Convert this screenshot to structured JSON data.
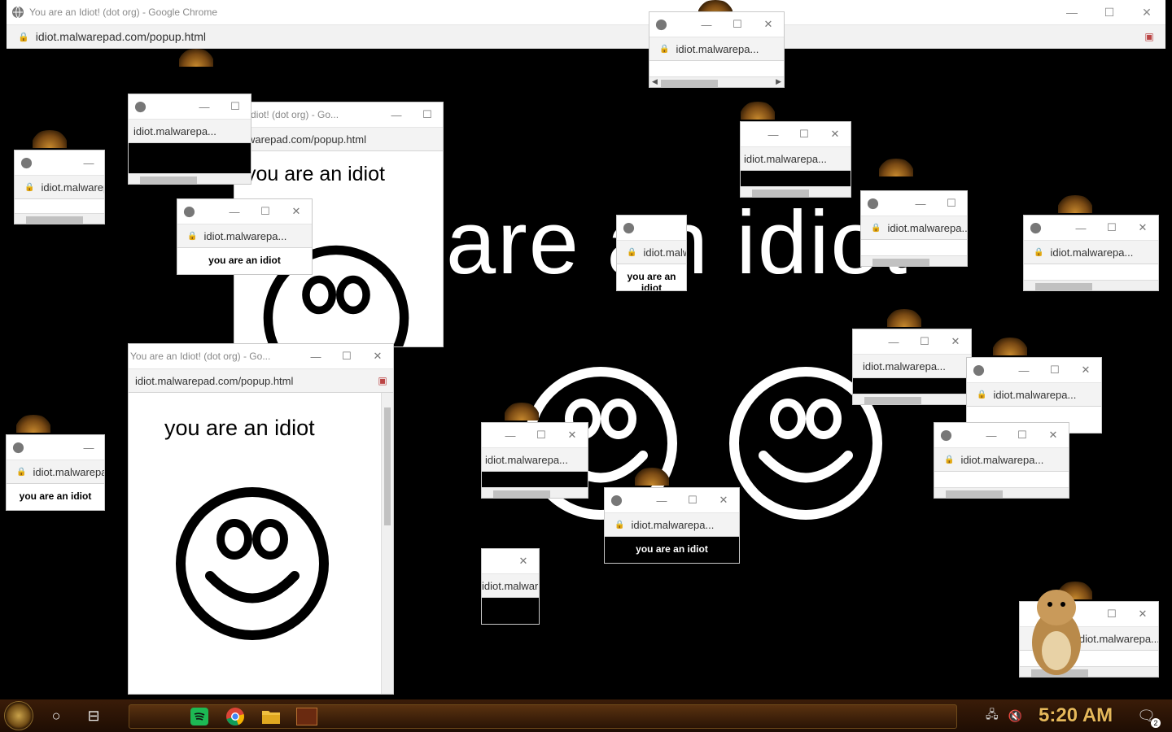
{
  "main_window": {
    "title": "You are an Idiot! (dot org) - Google Chrome",
    "url": "idiot.malwarepad.com/popup.html",
    "big_text": "are an idiot"
  },
  "popup_common": {
    "title_short": "You are an Idiot! (dot org) - Go...",
    "url_truncated": "idiot.malwarepa...",
    "url_full": "idiot.malwarepad.com/popup.html",
    "body_text": "you are an idiot"
  },
  "big_popup": {
    "title": "You are an Idiot! (dot org) - Go...",
    "url": "idiot.malwarepad.com/popup.html",
    "heading": "you are an idiot"
  },
  "behind_popup": {
    "url": "warepad.com/popup.html",
    "heading": "you are an idiot",
    "title": "an Idiot! (dot org) - Go..."
  },
  "taskbar": {
    "clock": "5:20 AM",
    "notification_count": "2"
  }
}
